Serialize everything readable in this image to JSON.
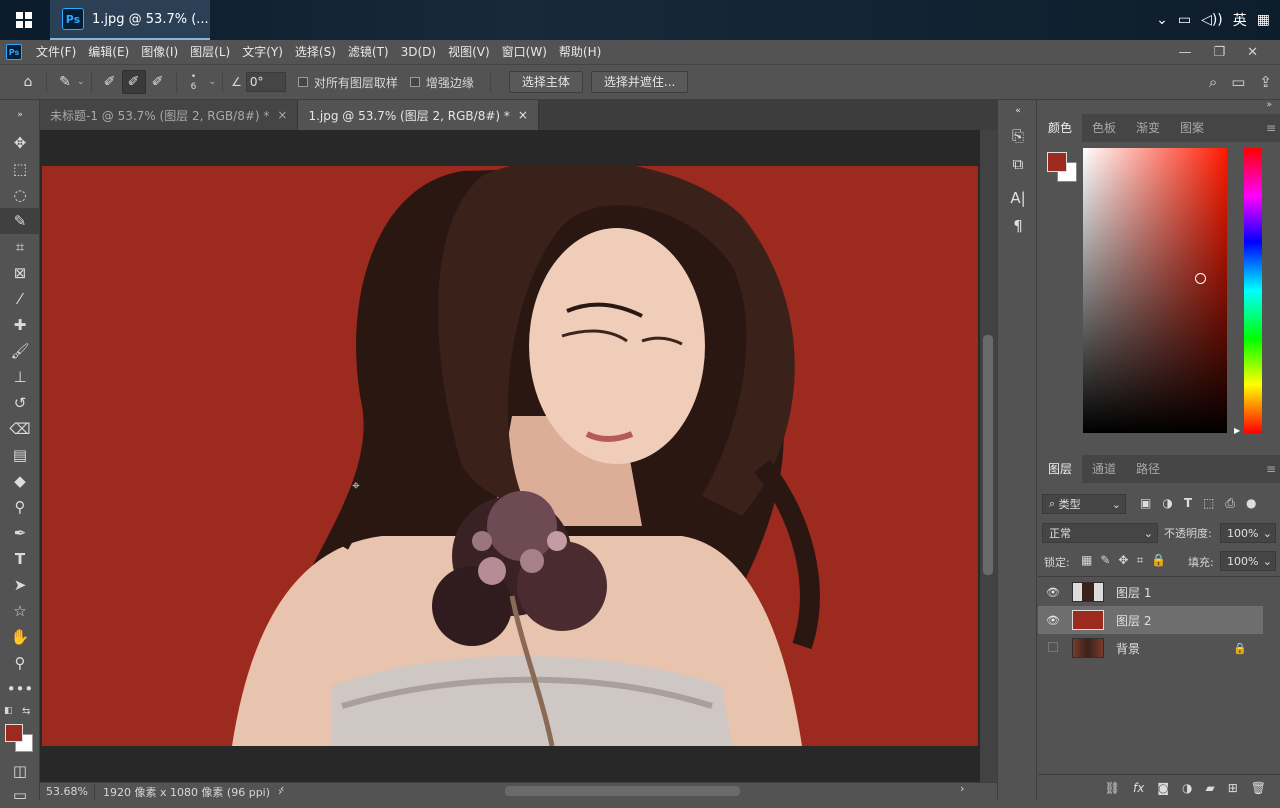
{
  "taskbar": {
    "task_title": "1.jpg @ 53.7% (...",
    "app_badge": "Ps",
    "ime": "英"
  },
  "menubar": {
    "app_badge": "Ps",
    "items": [
      "文件(F)",
      "编辑(E)",
      "图像(I)",
      "图层(L)",
      "文字(Y)",
      "选择(S)",
      "滤镜(T)",
      "3D(D)",
      "视图(V)",
      "窗口(W)",
      "帮助(H)"
    ]
  },
  "options": {
    "brush_size": "6",
    "angle": "0°",
    "sample_all_layers": "对所有图层取样",
    "enhance_edge": "增强边缘",
    "select_subject": "选择主体",
    "select_and_mask": "选择并遮住..."
  },
  "tabs": [
    {
      "label": "未标题-1 @ 53.7% (图层 2, RGB/8#) *",
      "close": "×"
    },
    {
      "label": "1.jpg @ 53.7% (图层 2, RGB/8#) *",
      "close": "×"
    }
  ],
  "status": {
    "zoom": "53.68%",
    "doc_info": "1920 像素 x 1080 像素 (96 ppi)"
  },
  "color_panel": {
    "tabs": [
      "颜色",
      "色板",
      "渐变",
      "图案"
    ],
    "foreground": "#9d2a1e",
    "background": "#ffffff"
  },
  "layers_panel": {
    "tabs": [
      "图层",
      "通道",
      "路径"
    ],
    "filter_kind": "类型",
    "blend_mode": "正常",
    "opacity_label": "不透明度:",
    "opacity_value": "100%",
    "lock_label": "锁定:",
    "fill_label": "填充:",
    "fill_value": "100%",
    "layers": [
      {
        "name": "图层 1",
        "visible": true,
        "selected": false
      },
      {
        "name": "图层 2",
        "visible": true,
        "selected": true
      },
      {
        "name": "背景",
        "visible": false,
        "selected": false
      }
    ]
  },
  "colors": {
    "canvas_bg": "#9d2a1e",
    "accent": "#31a8ff"
  }
}
